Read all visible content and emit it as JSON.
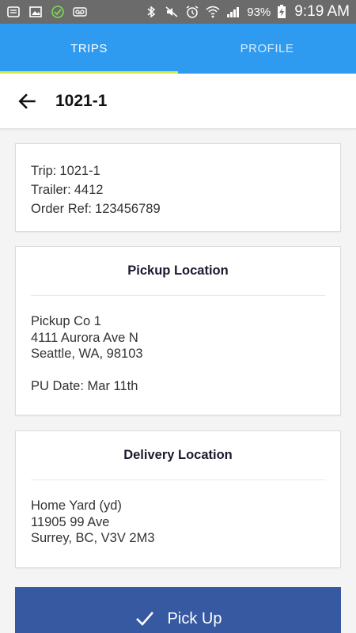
{
  "status_bar": {
    "battery": "93%",
    "time": "9:19 AM",
    "icons_left": [
      "notification-icon",
      "image-icon",
      "check-circle-icon",
      "voicemail-icon"
    ],
    "icons_right": [
      "bluetooth-icon",
      "mute-icon",
      "alarm-icon",
      "wifi-icon",
      "signal-icon",
      "battery-charging-icon"
    ]
  },
  "tabs": [
    {
      "label": "TRIPS",
      "active": true
    },
    {
      "label": "PROFILE",
      "active": false
    }
  ],
  "header": {
    "title": "1021-1",
    "back_icon": "arrow-left-icon"
  },
  "trip_info": {
    "trip": {
      "label": "Trip:",
      "value": "1021-1"
    },
    "trailer": {
      "label": "Trailer:",
      "value": "4412"
    },
    "order_ref": {
      "label": "Order Ref:",
      "value": "123456789"
    }
  },
  "pickup": {
    "title": "Pickup Location",
    "name": "Pickup Co 1",
    "street": "4111 Aurora Ave N",
    "city_line": "Seattle, WA, 98103",
    "date": "PU Date: Mar 11th"
  },
  "delivery": {
    "title": "Delivery Location",
    "name": "Home Yard (yd)",
    "street": "11905 99 Ave",
    "city_line": "Surrey, BC, V3V 2M3"
  },
  "action": {
    "label": "Pick Up",
    "icon": "check-icon"
  },
  "colors": {
    "tab_bar": "#2f9bf0",
    "tab_indicator": "#d7e84a",
    "action_button": "#3659a2",
    "status_bar": "#6b6b6b"
  }
}
